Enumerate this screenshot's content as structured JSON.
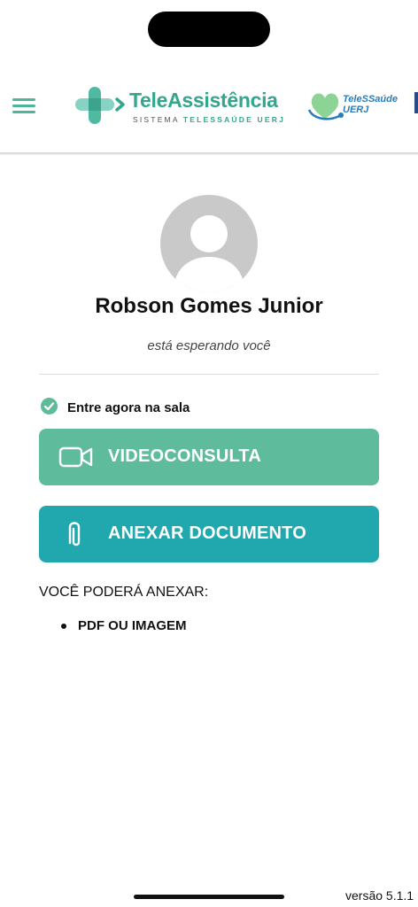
{
  "header": {
    "logo_title": "TeleAssistência",
    "logo_subtitle_prefix": "SISTEMA",
    "logo_subtitle_highlight": "TELESSAÚDE UERJ",
    "partner_logo_line1": "TeleSSaúde",
    "partner_logo_line2": "UERJ"
  },
  "patient": {
    "name": "Robson Gomes Junior",
    "status": "está esperando você"
  },
  "room": {
    "status_text": "Entre agora na sala"
  },
  "actions": {
    "video_label": "VIDEOCONSULTA",
    "attach_label": "ANEXAR DOCUMENTO"
  },
  "attachments": {
    "title": "VOCÊ PODERÁ ANEXAR:",
    "items": [
      "PDF OU IMAGEM"
    ]
  },
  "footer": {
    "version": "versão 5.1.1"
  },
  "colors": {
    "brand_green": "#34a68d",
    "video_button": "#5ebb9c",
    "attach_button": "#21a7ae",
    "partner_blue": "#2a7db8"
  }
}
